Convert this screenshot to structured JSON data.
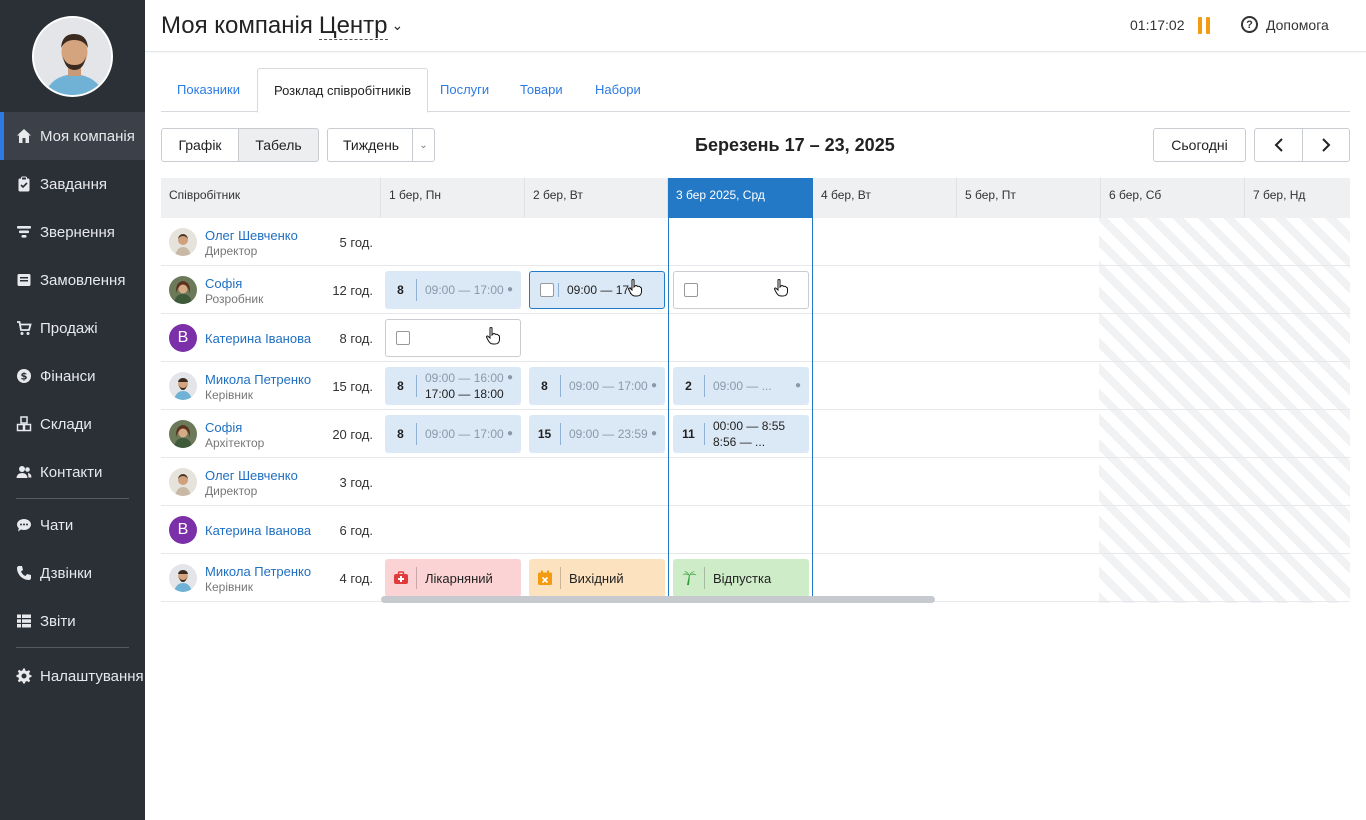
{
  "sidebar": {
    "items": [
      {
        "label": "Моя компанія",
        "icon": "home-icon"
      },
      {
        "label": "Завдання",
        "icon": "clipboard-icon"
      },
      {
        "label": "Звернення",
        "icon": "funnel-icon"
      },
      {
        "label": "Замовлення",
        "icon": "order-icon"
      },
      {
        "label": "Продажі",
        "icon": "cart-icon"
      },
      {
        "label": "Фінанси",
        "icon": "coin-icon"
      },
      {
        "label": "Склади",
        "icon": "boxes-icon"
      },
      {
        "label": "Контакти",
        "icon": "people-icon"
      },
      {
        "label": "Чати",
        "icon": "chat-icon"
      },
      {
        "label": "Дзвінки",
        "icon": "phone-icon"
      },
      {
        "label": "Звіти",
        "icon": "table-icon"
      },
      {
        "label": "Налаштування",
        "icon": "gear-icon"
      }
    ]
  },
  "header": {
    "title": "Моя компанія",
    "branch": "Центр",
    "clock": "01:17:02",
    "help": "Допомога"
  },
  "tabs": [
    "Показники",
    "Розклад співробітників",
    "Послуги",
    "Товари",
    "Набори"
  ],
  "toolbar": {
    "view_graph": "Графік",
    "view_table": "Табель",
    "range": "Тиждень",
    "period": "Березень 17 – 23, 2025",
    "today": "Сьогодні"
  },
  "grid": {
    "employee_header": "Співробітник",
    "days": [
      "1 бер, Пн",
      "2 бер, Вт",
      "3 бер 2025, Срд",
      "4 бер, Вт",
      "5 бер, Пт",
      "6 бер, Сб",
      "7 бер, Нд"
    ],
    "rows": [
      {
        "name": "Олег Шевченко",
        "role": "Директор",
        "hours": "5 год."
      },
      {
        "name": "Софія",
        "role": "Розробник",
        "hours": "12 год."
      },
      {
        "name": "Катерина Іванова",
        "role": "",
        "hours": "8 год.",
        "letter": "В"
      },
      {
        "name": "Микола Петренко",
        "role": "Керівник",
        "hours": "15 год."
      },
      {
        "name": "Софія",
        "role": "Архітектор",
        "hours": "20 год."
      },
      {
        "name": "Олег Шевченко",
        "role": "Директор",
        "hours": "3 год."
      },
      {
        "name": "Катерина Іванова",
        "role": "",
        "hours": "6 год.",
        "letter": "В"
      },
      {
        "name": "Микола Петренко",
        "role": "Керівник",
        "hours": "4 год."
      }
    ],
    "cells": {
      "r1_d1": {
        "num": "8",
        "time": "09:00 — 17:00"
      },
      "r1_d2": {
        "time": "09:00 — 17:00"
      },
      "r3_d1": {
        "num": "8",
        "time1": "09:00 — 16:00",
        "time2": "17:00 — 18:00"
      },
      "r3_d2": {
        "num": "8",
        "time": "09:00 — 17:00"
      },
      "r3_d3": {
        "num": "2",
        "time": "09:00 — ..."
      },
      "r4_d1": {
        "num": "8",
        "time": "09:00 — 17:00"
      },
      "r4_d2": {
        "num": "15",
        "time": "09:00 — 23:59"
      },
      "r4_d3": {
        "num": "11",
        "time1": "00:00 — 8:55",
        "time2": "8:56 — ..."
      },
      "r7_d1": {
        "label": "Лікарняний"
      },
      "r7_d2": {
        "label": "Вихідний"
      },
      "r7_d3": {
        "label": "Відпустка"
      }
    }
  },
  "colors": {
    "accent": "#2379c6",
    "sidebar": "#2b2f36",
    "pause": "#f39c12",
    "sick": "#fbd3d4",
    "dayoff": "#fde2bf",
    "vacation": "#cfecc8"
  }
}
